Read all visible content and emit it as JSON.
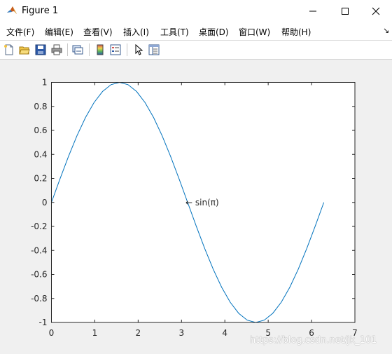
{
  "window": {
    "title": "Figure 1",
    "controls": [
      "minimize",
      "maximize",
      "close"
    ]
  },
  "menubar": {
    "items": [
      {
        "label": "文件(F)"
      },
      {
        "label": "编辑(E)"
      },
      {
        "label": "查看(V)"
      },
      {
        "label": "插入(I)"
      },
      {
        "label": "工具(T)"
      },
      {
        "label": "桌面(D)"
      },
      {
        "label": "窗口(W)"
      },
      {
        "label": "帮助(H)"
      }
    ],
    "overflow_icon": "arrow-icon"
  },
  "toolbar": {
    "buttons": [
      {
        "icon": "new-figure-icon"
      },
      {
        "icon": "open-file-icon"
      },
      {
        "icon": "save-icon"
      },
      {
        "icon": "print-icon"
      },
      {
        "icon": "link-plot-icon"
      },
      {
        "icon": "insert-colorbar-icon"
      },
      {
        "icon": "insert-legend-icon"
      },
      {
        "icon": "edit-plot-pointer-icon"
      },
      {
        "icon": "property-inspector-icon"
      }
    ]
  },
  "chart_data": {
    "type": "line",
    "function": "sin(x)",
    "title": "",
    "xlabel": "",
    "ylabel": "",
    "xlim": [
      0,
      7
    ],
    "ylim": [
      -1,
      1
    ],
    "xticks": [
      "0",
      "1",
      "2",
      "3",
      "4",
      "5",
      "6",
      "7"
    ],
    "yticks": [
      "1",
      "0.8",
      "0.6",
      "0.4",
      "0.2",
      "0",
      "-0.2",
      "-0.4",
      "-0.6",
      "-0.8",
      "-1"
    ],
    "grid": false,
    "series": [
      {
        "color": "#0072bd",
        "x": [
          0,
          0.1963,
          0.3927,
          0.589,
          0.7854,
          0.9817,
          1.1781,
          1.3744,
          1.5708,
          1.7671,
          1.9635,
          2.1598,
          2.3562,
          2.5525,
          2.7489,
          2.9452,
          3.1416,
          3.3379,
          3.5343,
          3.7306,
          3.927,
          4.1233,
          4.3197,
          4.516,
          4.7124,
          4.9087,
          5.1051,
          5.3014,
          5.4978,
          5.6941,
          5.8905,
          6.0868,
          6.2832
        ],
        "y": [
          0,
          0.1951,
          0.3827,
          0.5556,
          0.7071,
          0.8315,
          0.9239,
          0.9808,
          1,
          0.9808,
          0.9239,
          0.8315,
          0.7071,
          0.5556,
          0.3827,
          0.1951,
          0,
          -0.1951,
          -0.3827,
          -0.5556,
          -0.7071,
          -0.8315,
          -0.9239,
          -0.9808,
          -1,
          -0.9808,
          -0.9239,
          -0.8315,
          -0.7071,
          -0.5556,
          -0.3827,
          -0.1951,
          0
        ]
      }
    ],
    "annotation": {
      "text": "←  sin(π)",
      "x": 3.1416,
      "y": 0
    }
  },
  "watermark": "https://blog.csdn.net/jk_101"
}
